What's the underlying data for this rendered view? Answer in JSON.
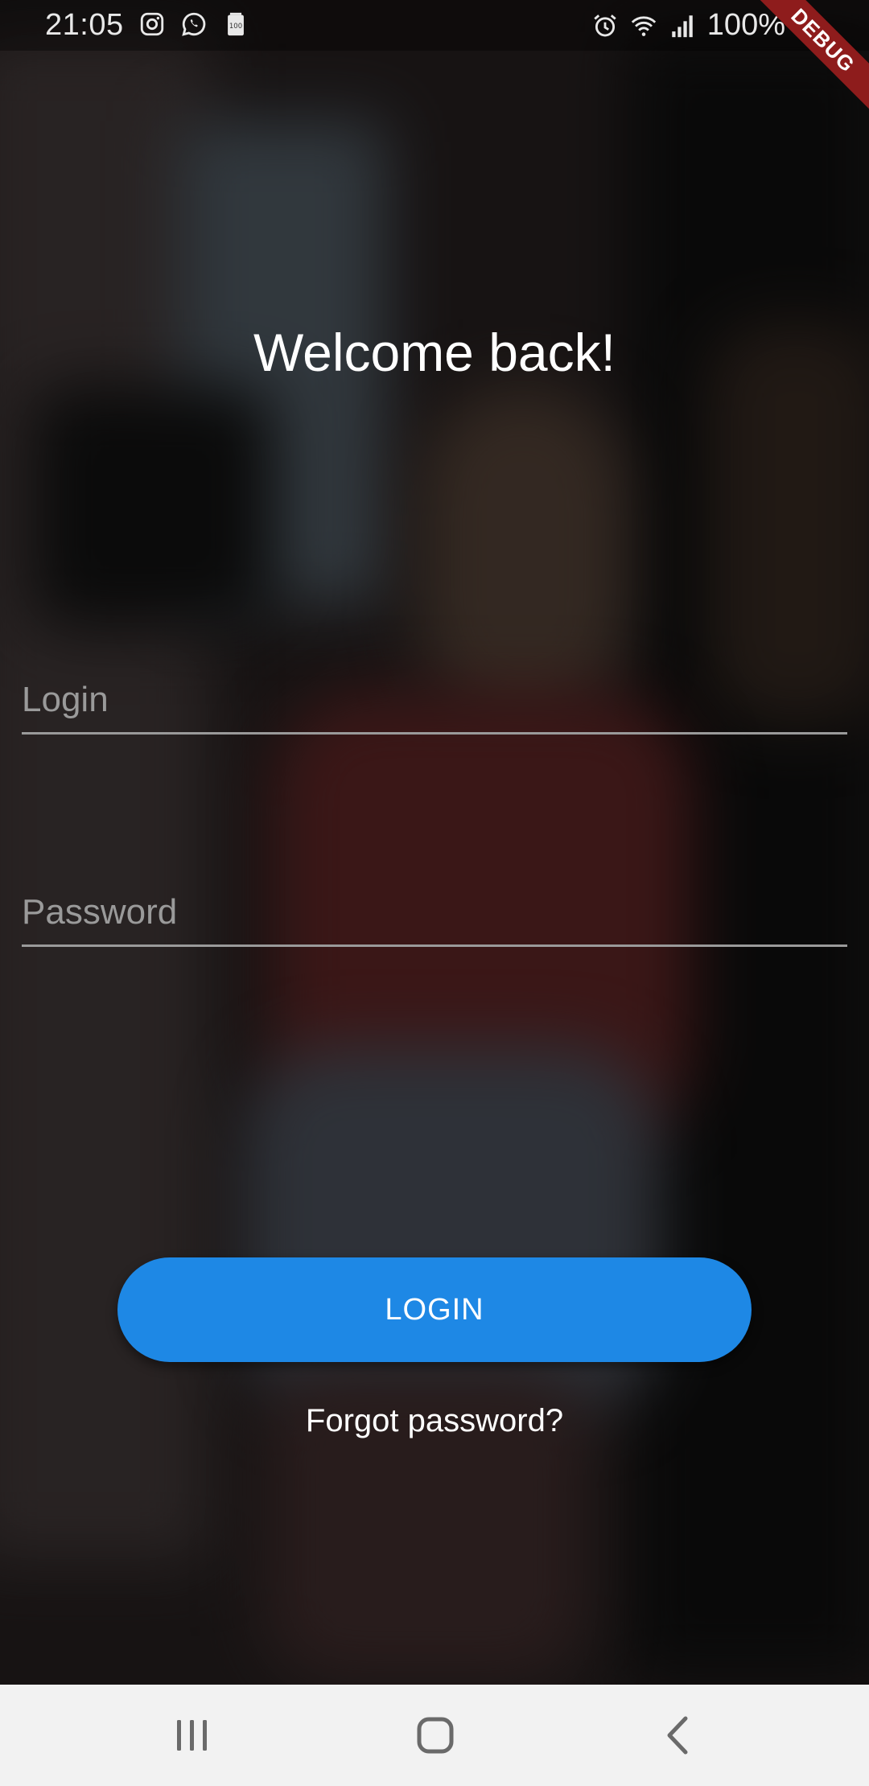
{
  "status_bar": {
    "time": "21:05",
    "battery": "100%",
    "left_icons": [
      "instagram-icon",
      "whatsapp-icon",
      "battery-100-icon"
    ],
    "right_icons": [
      "alarm-icon",
      "wifi-icon",
      "signal-icon",
      "battery-icon"
    ]
  },
  "debug_banner": "DEBUG",
  "welcome_title": "Welcome back!",
  "login_field": {
    "placeholder": "Login",
    "value": ""
  },
  "password_field": {
    "placeholder": "Password",
    "value": ""
  },
  "login_button": "LOGIN",
  "forgot_password": "Forgot password?",
  "nav_bar": [
    "recents-icon",
    "home-icon",
    "back-icon"
  ],
  "colors": {
    "accent": "#1e88e5",
    "debug": "#8e1c1c",
    "underline": "#9a9a9a",
    "nav_bg": "#f2f2f2"
  }
}
